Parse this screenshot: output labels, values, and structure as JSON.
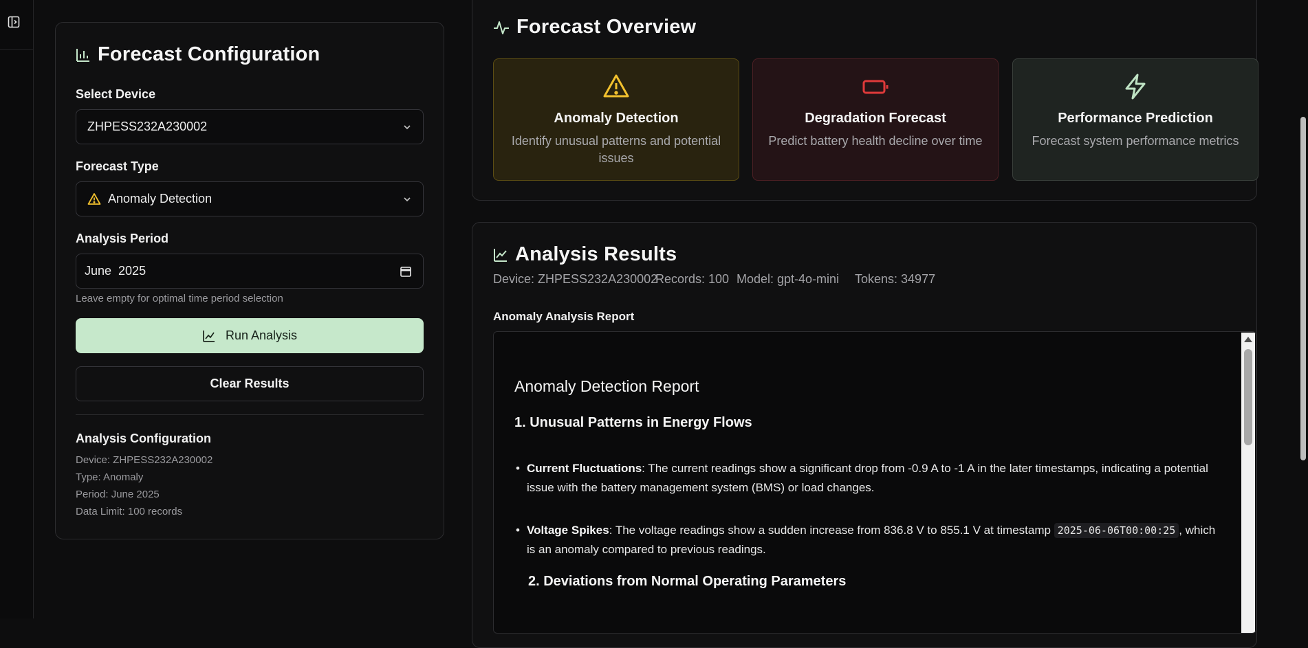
{
  "config": {
    "title": "Forecast Configuration",
    "select_device_label": "Select Device",
    "device_value": "ZHPESS232A230002",
    "forecast_type_label": "Forecast Type",
    "forecast_type_value": "Anomaly Detection",
    "analysis_period_label": "Analysis Period",
    "analysis_period_value": "June  2025",
    "period_hint": "Leave empty for optimal time period selection",
    "run_label": "Run Analysis",
    "clear_label": "Clear Results",
    "summary_title": "Analysis Configuration",
    "summary_device": "Device: ZHPESS232A230002",
    "summary_type": "Type: Anomaly",
    "summary_period": "Period: June 2025",
    "summary_limit": "Data Limit: 100 records"
  },
  "overview": {
    "title": "Forecast Overview",
    "tiles": [
      {
        "title": "Anomaly Detection",
        "desc": "Identify unusual patterns and potential issues",
        "icon": "warning-triangle-icon",
        "accent": "#f2c12e"
      },
      {
        "title": "Degradation Forecast",
        "desc": "Predict battery health decline over time",
        "icon": "battery-icon",
        "accent": "#e03a3a"
      },
      {
        "title": "Performance Prediction",
        "desc": "Forecast system performance metrics",
        "icon": "lightning-icon",
        "accent": "#bfe3c4"
      }
    ]
  },
  "results": {
    "title": "Analysis Results",
    "device": "Device: ZHPESS232A230002",
    "records": "Records: 100",
    "model": "Model: gpt-4o-mini",
    "tokens": "Tokens: 34977",
    "report_label": "Anomaly Analysis Report",
    "report": {
      "heading": "Anomaly Detection Report",
      "section1": "1. Unusual Patterns in Energy Flows",
      "b1_bold": "Current Fluctuations",
      "b1_text": ": The current readings show a significant drop from -0.9 A to -1 A in the later timestamps, indicating a potential issue with the battery management system (BMS) or load changes.",
      "b2_bold": "Voltage Spikes",
      "b2_text_a": ": The voltage readings show a sudden increase from 836.8 V to 855.1 V at timestamp ",
      "b2_code": "2025-06-06T00:00:25",
      "b2_text_b": ", which is an anomaly compared to previous readings.",
      "section2": "2. Deviations from Normal Operating Parameters"
    }
  },
  "colors": {
    "accent_green": "#c6e8cb",
    "warning_yellow": "#f2c12e",
    "alert_red": "#e03a3a"
  }
}
